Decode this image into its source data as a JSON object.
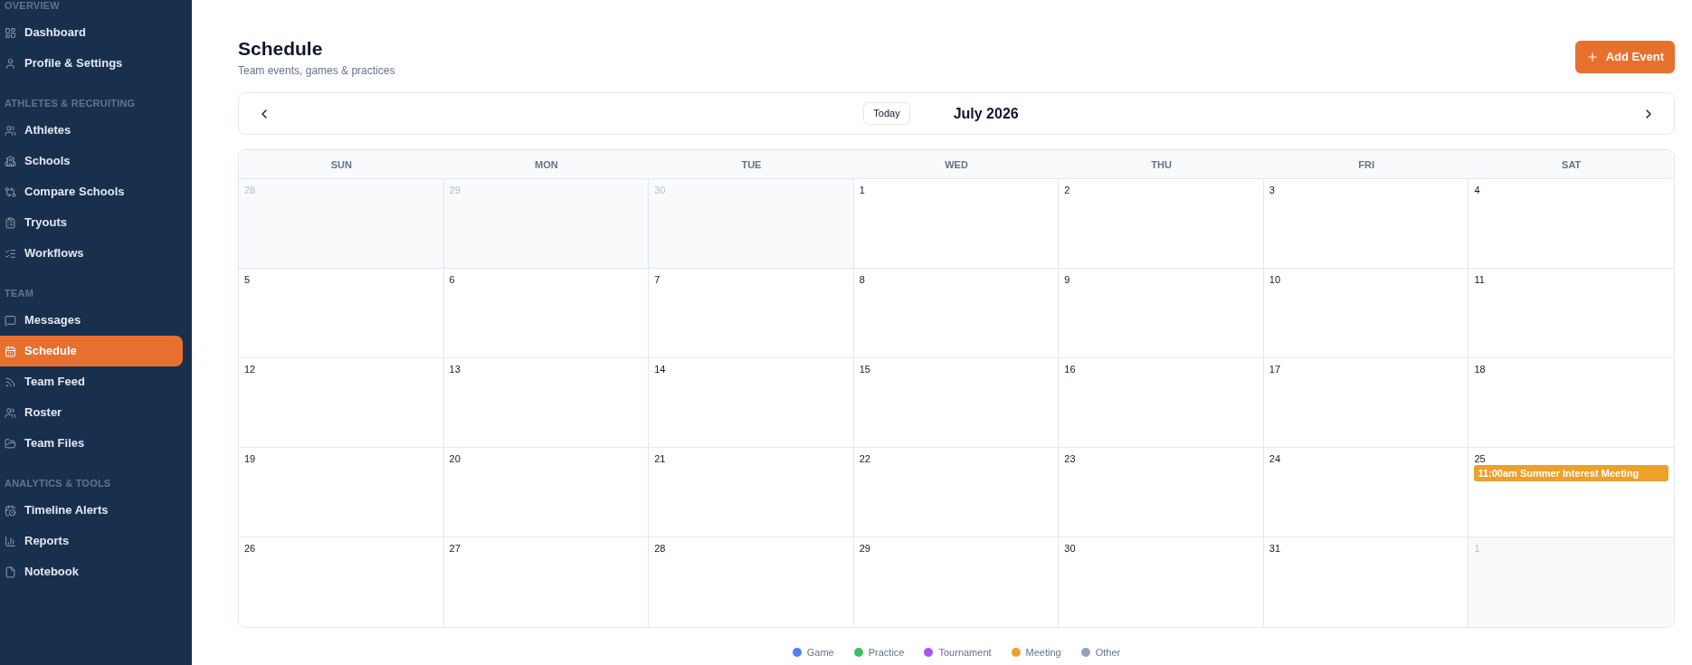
{
  "sidebar": {
    "sections": [
      {
        "title": "OVERVIEW",
        "items": [
          {
            "label": "Dashboard",
            "selected": false
          },
          {
            "label": "Profile & Settings",
            "selected": false
          }
        ]
      },
      {
        "title": "ATHLETES & RECRUITING",
        "items": [
          {
            "label": "Athletes",
            "selected": false
          },
          {
            "label": "Schools",
            "selected": false
          },
          {
            "label": "Compare Schools",
            "selected": false
          },
          {
            "label": "Tryouts",
            "selected": false
          },
          {
            "label": "Workflows",
            "selected": false
          }
        ]
      },
      {
        "title": "TEAM",
        "items": [
          {
            "label": "Messages",
            "selected": false
          },
          {
            "label": "Schedule",
            "selected": true
          },
          {
            "label": "Team Feed",
            "selected": false
          },
          {
            "label": "Roster",
            "selected": false
          },
          {
            "label": "Team Files",
            "selected": false
          }
        ]
      },
      {
        "title": "ANALYTICS & TOOLS",
        "items": [
          {
            "label": "Timeline Alerts",
            "selected": false
          },
          {
            "label": "Reports",
            "selected": false
          },
          {
            "label": "Notebook",
            "selected": false
          }
        ]
      }
    ]
  },
  "header": {
    "title": "Schedule",
    "subtitle": "Team events, games & practices",
    "add_event_button": "Add Event"
  },
  "calendar_nav": {
    "today_button": "Today",
    "month_label": "July 2026"
  },
  "calendar": {
    "weekdays": [
      "SUN",
      "MON",
      "TUE",
      "WED",
      "THU",
      "FRI",
      "SAT"
    ],
    "weeks": [
      [
        {
          "day": "28",
          "outside": true
        },
        {
          "day": "29",
          "outside": true
        },
        {
          "day": "30",
          "outside": true
        },
        {
          "day": "1",
          "outside": false
        },
        {
          "day": "2",
          "outside": false
        },
        {
          "day": "3",
          "outside": false
        },
        {
          "day": "4",
          "outside": false
        }
      ],
      [
        {
          "day": "5",
          "outside": false
        },
        {
          "day": "6",
          "outside": false
        },
        {
          "day": "7",
          "outside": false
        },
        {
          "day": "8",
          "outside": false
        },
        {
          "day": "9",
          "outside": false
        },
        {
          "day": "10",
          "outside": false
        },
        {
          "day": "11",
          "outside": false
        }
      ],
      [
        {
          "day": "12",
          "outside": false
        },
        {
          "day": "13",
          "outside": false
        },
        {
          "day": "14",
          "outside": false
        },
        {
          "day": "15",
          "outside": false
        },
        {
          "day": "16",
          "outside": false
        },
        {
          "day": "17",
          "outside": false
        },
        {
          "day": "18",
          "outside": false
        }
      ],
      [
        {
          "day": "19",
          "outside": false
        },
        {
          "day": "20",
          "outside": false
        },
        {
          "day": "21",
          "outside": false
        },
        {
          "day": "22",
          "outside": false
        },
        {
          "day": "23",
          "outside": false
        },
        {
          "day": "24",
          "outside": false
        },
        {
          "day": "25",
          "outside": false,
          "events": [
            {
              "label": "11:00am Summer Interest Meeting",
              "color": "#eda02a"
            }
          ]
        }
      ],
      [
        {
          "day": "26",
          "outside": false
        },
        {
          "day": "27",
          "outside": false
        },
        {
          "day": "28",
          "outside": false
        },
        {
          "day": "29",
          "outside": false
        },
        {
          "day": "30",
          "outside": false
        },
        {
          "day": "31",
          "outside": false
        },
        {
          "day": "1",
          "outside": true
        }
      ]
    ]
  },
  "legend": [
    {
      "label": "Game",
      "color": "#4f7ff0"
    },
    {
      "label": "Practice",
      "color": "#3cc060"
    },
    {
      "label": "Tournament",
      "color": "#a855f7"
    },
    {
      "label": "Meeting",
      "color": "#f0a028"
    },
    {
      "label": "Other",
      "color": "#94a3b8"
    }
  ]
}
